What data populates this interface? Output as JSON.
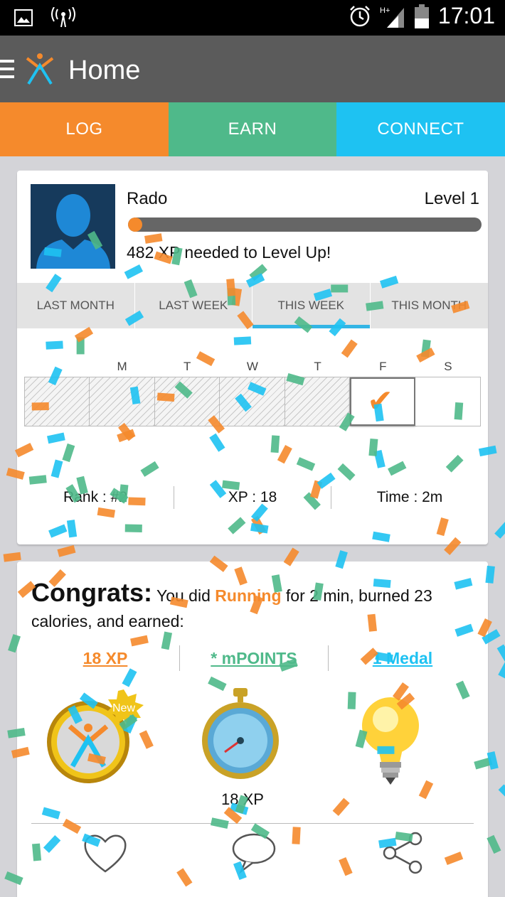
{
  "status_bar": {
    "time": "17:01"
  },
  "app_bar": {
    "title": "Home"
  },
  "tabs": [
    {
      "label": "LOG",
      "color": "#f58a2c"
    },
    {
      "label": "EARN",
      "color": "#4fb98a"
    },
    {
      "label": "CONNECT",
      "color": "#1ec2f2"
    }
  ],
  "profile": {
    "name": "Rado",
    "level": "Level 1",
    "xp_progress": 0.04,
    "xp_needed": "482 XP needed to Level Up!"
  },
  "period_tabs": [
    "LAST MONTH",
    "LAST WEEK",
    "THIS WEEK",
    "THIS MONTH"
  ],
  "active_period": "THIS WEEK",
  "week": {
    "day_labels": [
      "",
      "M",
      "T",
      "W",
      "T",
      "F",
      "S"
    ],
    "today": "F"
  },
  "stats": {
    "rank": "Rank : #2",
    "xp": "XP : 18",
    "time": "Time : 2m"
  },
  "congrats": {
    "heading": "Congrats:",
    "prefix": "You did ",
    "activity": "Running",
    "suffix": " for 2 min, burned 23 calories, and earned:"
  },
  "rewards": {
    "xp": "18 XP",
    "mpoints": "* mPOINTS",
    "medal": "1 Medal"
  },
  "badges": {
    "new_label": "New",
    "stopwatch_caption": "18 XP"
  },
  "actions": [
    "heart-icon",
    "comment-icon",
    "share-icon"
  ]
}
